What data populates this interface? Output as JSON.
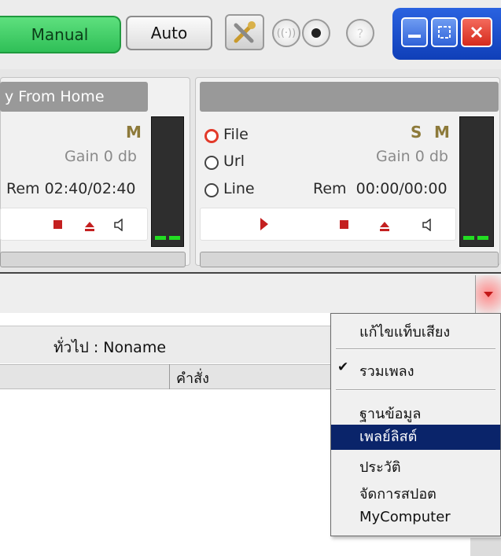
{
  "toolbar": {
    "manual_label": "Manual",
    "auto_label": "Auto",
    "icons": [
      "tools-icon",
      "broadcast-icon",
      "record-icon",
      "help-icon"
    ],
    "window_buttons": [
      "minimize-icon",
      "fullscreen-icon",
      "close-icon"
    ],
    "colors": {
      "manual": "#33c35c",
      "window_frame": "#1d4fd0",
      "close": "#e5231c"
    }
  },
  "player_left": {
    "title": "y From Home",
    "badge_m": "M",
    "gain": "Gain 0 db",
    "rem": "Rem 02:40/02:40"
  },
  "player_right": {
    "title": "",
    "source_options": [
      "File",
      "Url",
      "Line"
    ],
    "selected_source": "File",
    "badge_s": "S",
    "badge_m": "M",
    "gain": "Gain 0 db",
    "rem": "Rem  00:00/00:00"
  },
  "list": {
    "header": "ทั่วไป : Noname",
    "column_command": "คำสั่ง"
  },
  "menu": {
    "items": [
      {
        "label": "แก้ไขแท็บเสียง",
        "checked": false
      },
      {
        "label": "รวมเพลง",
        "checked": true
      },
      {
        "label": "ฐานข้อมูล",
        "checked": false
      },
      {
        "label": "เพลย์ลิสต์",
        "checked": false,
        "highlighted": true
      },
      {
        "label": "ประวัติ",
        "checked": false
      },
      {
        "label": "จัดการสปอต",
        "checked": false
      },
      {
        "label": "MyComputer",
        "checked": false
      }
    ],
    "check_mark": "✔",
    "highlight_color": "#0a246a"
  }
}
